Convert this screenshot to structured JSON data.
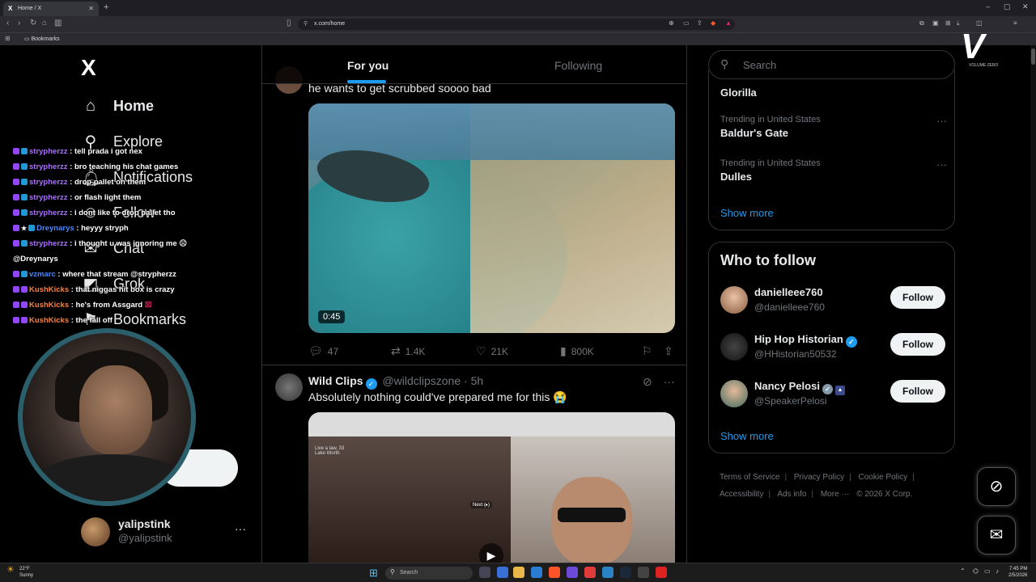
{
  "browser": {
    "tab_title": "Home / X",
    "tab_favicon": "X",
    "new_tab": "+",
    "url": "x.com/home",
    "bookmarks_folder": "Bookmarks"
  },
  "leftnav": {
    "logo": "X",
    "items": [
      {
        "label": "Home",
        "icon": "home-icon"
      },
      {
        "label": "Explore",
        "icon": "search-icon"
      },
      {
        "label": "Notifications",
        "icon": "bell-icon"
      },
      {
        "label": "Follow",
        "icon": "person-icon"
      },
      {
        "label": "Chat",
        "icon": "mail-icon"
      },
      {
        "label": "Grok",
        "icon": "grok-icon"
      },
      {
        "label": "Bookmarks",
        "icon": "bookmark-icon"
      }
    ],
    "account": {
      "name": "yalipstink",
      "handle": "@yalipstink",
      "more": "···"
    }
  },
  "chat": [
    {
      "user": "strypherzz",
      "color": "purple",
      "msg": ": tell prada i got nex"
    },
    {
      "user": "strypherzz",
      "color": "purple",
      "msg": ": bro teaching his chat games"
    },
    {
      "user": "strypherzz",
      "color": "purple",
      "msg": ": drop pallet on them"
    },
    {
      "user": "strypherzz",
      "color": "purple",
      "msg": ": or flash light them"
    },
    {
      "user": "strypherzz",
      "color": "purple",
      "msg": ": i dont like to drop pallet tho"
    },
    {
      "user": "Dreynarys",
      "color": "blue",
      "msg": ": heyyy stryph"
    },
    {
      "user": "strypherzz",
      "color": "purple",
      "msg": ": i thought u was ignoring me"
    },
    {
      "user": "",
      "color": "none",
      "msg": "@Dreynarys"
    },
    {
      "user": "vzmarc",
      "color": "blue",
      "msg": ": where that stream @strypherzz"
    },
    {
      "user": "KushKicks",
      "color": "orange",
      "msg": ": that niggas hit box is crazy"
    },
    {
      "user": "KushKicks",
      "color": "orange",
      "msg": ": he's from Assgard"
    },
    {
      "user": "KushKicks",
      "color": "orange",
      "msg": ": the fall off"
    }
  ],
  "main": {
    "tabs": {
      "for_you": "For you",
      "following": "Following"
    },
    "post1": {
      "text": "he wants to get scrubbed soooo bad",
      "video_time": "0:45",
      "replies": "47",
      "reposts": "1.4K",
      "likes": "21K",
      "views": "800K"
    },
    "post2": {
      "name": "Wild Clips",
      "handle": "@wildclipszone",
      "time": "· 5h",
      "text": "Absolutely nothing could've prepared me for this 😭",
      "overlay_label": "Live a law, 33",
      "overlay_sub": "Lake Worth",
      "overlay_next": "Next (▸)"
    }
  },
  "right": {
    "search_placeholder": "Search",
    "trends": [
      {
        "category": "",
        "topic": "Glorilla"
      },
      {
        "category": "Trending in United States",
        "topic": "Baldur's Gate"
      },
      {
        "category": "Trending in United States",
        "topic": "Dulles"
      }
    ],
    "show_more": "Show more",
    "who_to_follow": {
      "title": "Who to follow",
      "users": [
        {
          "name": "danielleee760",
          "handle": "@danielleee760",
          "button": "Follow"
        },
        {
          "name": "Hip Hop Historian",
          "handle": "@HHistorian50532",
          "button": "Follow"
        },
        {
          "name": "Nancy Pelosi",
          "handle": "@SpeakerPelosi",
          "button": "Follow"
        }
      ],
      "show_more": "Show more"
    },
    "footer": {
      "terms": "Terms of Service",
      "privacy": "Privacy Policy",
      "cookie": "Cookie Policy",
      "accessibility": "Accessibility",
      "ads": "Ads info",
      "more": "More ···",
      "copyright": "© 2026 X Corp."
    }
  },
  "brand": {
    "mark": "V",
    "caption": "VOLUME ZERO"
  },
  "taskbar": {
    "temp": "22°F",
    "condition": "Sunny",
    "search": "Search",
    "time": "7:45 PM",
    "date": "2/5/2026"
  },
  "colors": {
    "accent": "#1d9bf0",
    "background": "#000000",
    "border": "#2f3336",
    "muted_text": "#71767b",
    "chat_purple": "#a970ff",
    "chat_blue": "#4a86ff",
    "chat_orange": "#ff7f3a"
  }
}
